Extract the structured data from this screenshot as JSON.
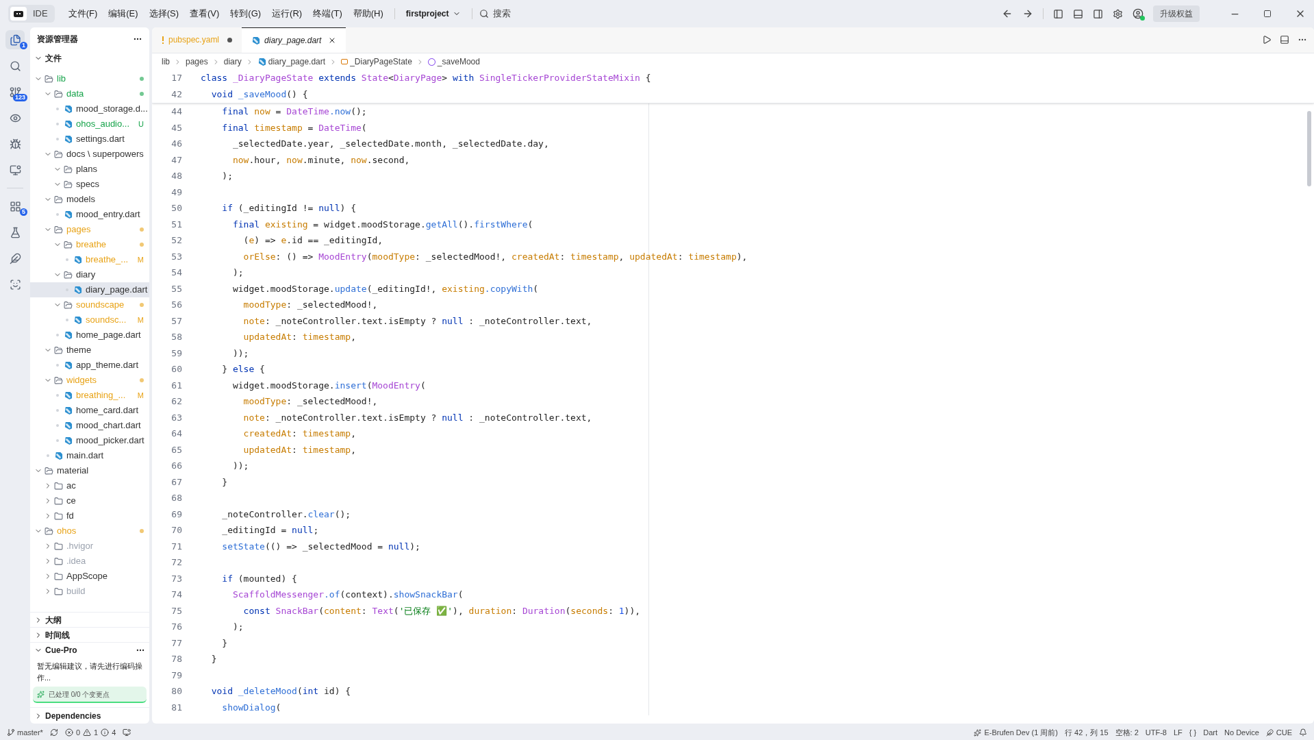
{
  "titlebar": {
    "app": "IDE",
    "menus": [
      "文件(F)",
      "编辑(E)",
      "选择(S)",
      "查看(V)",
      "转到(G)",
      "运行(R)",
      "终端(T)",
      "帮助(H)"
    ],
    "project": "firstproject",
    "search": "搜索",
    "upgrade": "升级权益"
  },
  "activity_bar": [
    {
      "badge": "1",
      "selected": true
    },
    {
      "selected": false
    },
    {
      "badge": "123",
      "selected": false
    },
    {
      "selected": false
    },
    {
      "selected": false
    },
    {
      "selected": false
    },
    {
      "badge": "5",
      "selected": false
    },
    {
      "selected": false
    },
    {
      "selected": false
    },
    {
      "selected": false
    }
  ],
  "explorer": {
    "title": "资源管理器",
    "section": "文件",
    "tree": [
      {
        "name": "lib",
        "kind": "folder",
        "expanded": true,
        "color": "#16a34a",
        "changed": true,
        "children": [
          {
            "name": "data",
            "kind": "folder",
            "expanded": true,
            "color": "#16a34a",
            "changed": true,
            "children": [
              {
                "name": "mood_storage.d...",
                "kind": "file",
                "color": "#333333",
                "selected": false
              },
              {
                "name": "ohos_audio...",
                "kind": "file",
                "color": "#16a34a",
                "badge": "U",
                "selected": false
              },
              {
                "name": "settings.dart",
                "kind": "file",
                "color": "#333333",
                "selected": false
              }
            ]
          },
          {
            "name": "docs \\ superpowers",
            "kind": "folder",
            "expanded": true,
            "color": "#333333",
            "changed": false,
            "children": [
              {
                "name": "plans",
                "kind": "folder",
                "expanded": true,
                "color": "#333333",
                "changed": false
              },
              {
                "name": "specs",
                "kind": "folder",
                "expanded": true,
                "color": "#333333",
                "changed": false
              }
            ]
          },
          {
            "name": "models",
            "kind": "folder",
            "expanded": true,
            "color": "#333333",
            "changed": false,
            "children": [
              {
                "name": "mood_entry.dart",
                "kind": "file",
                "color": "#333333",
                "selected": false
              }
            ]
          },
          {
            "name": "pages",
            "kind": "folder",
            "expanded": true,
            "color": "#e8a317",
            "changed": true,
            "children": [
              {
                "name": "breathe",
                "kind": "folder",
                "expanded": true,
                "color": "#e8a317",
                "changed": true,
                "children": [
                  {
                    "name": "breathe_...",
                    "kind": "file",
                    "color": "#e8a317",
                    "badge": "M",
                    "selected": false
                  }
                ]
              },
              {
                "name": "diary",
                "kind": "folder",
                "expanded": true,
                "color": "#333333",
                "changed": false,
                "children": [
                  {
                    "name": "diary_page.dart",
                    "kind": "file",
                    "color": "#333333",
                    "selected": true
                  }
                ]
              },
              {
                "name": "soundscape",
                "kind": "folder",
                "expanded": true,
                "color": "#e8a317",
                "changed": true,
                "children": [
                  {
                    "name": "soundsc...",
                    "kind": "file",
                    "color": "#e8a317",
                    "badge": "M",
                    "selected": false
                  }
                ]
              },
              {
                "name": "home_page.dart",
                "kind": "file",
                "color": "#333333",
                "selected": false
              }
            ]
          },
          {
            "name": "theme",
            "kind": "folder",
            "expanded": true,
            "color": "#333333",
            "changed": false,
            "children": [
              {
                "name": "app_theme.dart",
                "kind": "file",
                "color": "#333333",
                "selected": false
              }
            ]
          },
          {
            "name": "widgets",
            "kind": "folder",
            "expanded": true,
            "color": "#e8a317",
            "changed": true,
            "children": [
              {
                "name": "breathing_...",
                "kind": "file",
                "color": "#e8a317",
                "badge": "M",
                "selected": false
              },
              {
                "name": "home_card.dart",
                "kind": "file",
                "color": "#333333",
                "selected": false
              },
              {
                "name": "mood_chart.dart",
                "kind": "file",
                "color": "#333333",
                "selected": false
              },
              {
                "name": "mood_picker.dart",
                "kind": "file",
                "color": "#333333",
                "selected": false
              }
            ]
          },
          {
            "name": "main.dart",
            "kind": "file",
            "color": "#333333",
            "selected": false
          }
        ]
      },
      {
        "name": "material",
        "kind": "folder",
        "expanded": true,
        "color": "#333333",
        "changed": false,
        "children": [
          {
            "name": "ac",
            "kind": "folder",
            "expanded": false,
            "color": "#333333",
            "changed": false
          },
          {
            "name": "ce",
            "kind": "folder",
            "expanded": false,
            "color": "#333333",
            "changed": false
          },
          {
            "name": "fd",
            "kind": "folder",
            "expanded": false,
            "color": "#333333",
            "changed": false
          }
        ]
      },
      {
        "name": "ohos",
        "kind": "folder",
        "expanded": true,
        "color": "#e8a317",
        "changed": true,
        "children": [
          {
            "name": ".hvigor",
            "kind": "folder",
            "expanded": false,
            "color": "#9ca3af",
            "changed": false
          },
          {
            "name": ".idea",
            "kind": "folder",
            "expanded": false,
            "color": "#9ca3af",
            "changed": false
          },
          {
            "name": "AppScope",
            "kind": "folder",
            "expanded": false,
            "color": "#333333",
            "changed": false
          },
          {
            "name": "build",
            "kind": "folder",
            "expanded": false,
            "color": "#9ca3af",
            "changed": false
          }
        ]
      }
    ]
  },
  "panels": [
    {
      "title": "大纲",
      "expanded": false
    },
    {
      "title": "时间线",
      "expanded": false
    }
  ],
  "cue_pro": {
    "title": "Cue-Pro",
    "expanded": true,
    "message": "暂无编辑建议，请先进行编码操作...",
    "progress": "已处理 0/0 个变更点"
  },
  "dependencies": {
    "title": "Dependencies",
    "expanded": false
  },
  "tabs": [
    {
      "label": "pubspec.yaml",
      "kind": "warning",
      "selected": false,
      "modified": true
    },
    {
      "label": "diary_page.dart",
      "kind": "dart",
      "selected": true,
      "modified": false
    }
  ],
  "breadcrumb": [
    {
      "label": "lib",
      "kind": "folder"
    },
    {
      "label": "pages",
      "kind": "folder"
    },
    {
      "label": "diary",
      "kind": "folder"
    },
    {
      "label": "diary_page.dart",
      "kind": "dart"
    },
    {
      "label": "_DiaryPageState",
      "kind": "class"
    },
    {
      "label": "_saveMood",
      "kind": "function"
    }
  ],
  "sticky_lines": [
    {
      "number": "17",
      "tokens": [
        {
          "kind": "k",
          "text": "class "
        },
        {
          "kind": "t",
          "text": "_DiaryPageState "
        },
        {
          "kind": "k",
          "text": "extends "
        },
        {
          "kind": "t",
          "text": "State"
        },
        {
          "kind": "p",
          "text": "<"
        },
        {
          "kind": "t",
          "text": "DiaryPage"
        },
        {
          "kind": "p",
          "text": "> "
        },
        {
          "kind": "k",
          "text": "with "
        },
        {
          "kind": "t",
          "text": "SingleTickerProviderStateMixin "
        },
        {
          "kind": "p",
          "text": "{"
        }
      ]
    },
    {
      "number": "42",
      "tokens": [
        {
          "kind": "k",
          "text": "  void "
        },
        {
          "kind": "m",
          "text": "_saveMood"
        },
        {
          "kind": "p",
          "text": "() {"
        }
      ]
    }
  ],
  "lines": [
    {
      "number": "44",
      "tokens": [
        {
          "kind": "k",
          "text": "    final "
        },
        {
          "kind": "f",
          "text": "now"
        },
        {
          "kind": "p",
          "text": " = "
        },
        {
          "kind": "t",
          "text": "DateTime"
        },
        {
          "kind": "m",
          "text": ".now"
        },
        {
          "kind": "p",
          "text": "();"
        }
      ]
    },
    {
      "number": "45",
      "tokens": [
        {
          "kind": "k",
          "text": "    final "
        },
        {
          "kind": "f",
          "text": "timestamp"
        },
        {
          "kind": "p",
          "text": " = "
        },
        {
          "kind": "t",
          "text": "DateTime"
        },
        {
          "kind": "p",
          "text": "("
        }
      ]
    },
    {
      "number": "46",
      "tokens": [
        {
          "kind": "p",
          "text": "      _selectedDate.year, _selectedDate.month, _selectedDate.day,"
        }
      ]
    },
    {
      "number": "47",
      "tokens": [
        {
          "kind": "f",
          "text": "      now"
        },
        {
          "kind": "p",
          "text": ".hour, "
        },
        {
          "kind": "f",
          "text": "now"
        },
        {
          "kind": "p",
          "text": ".minute, "
        },
        {
          "kind": "f",
          "text": "now"
        },
        {
          "kind": "p",
          "text": ".second,"
        }
      ]
    },
    {
      "number": "48",
      "tokens": [
        {
          "kind": "p",
          "text": "    );"
        }
      ]
    },
    {
      "number": "49"
    },
    {
      "number": "50",
      "tokens": [
        {
          "kind": "k",
          "text": "    if "
        },
        {
          "kind": "p",
          "text": "(_editingId != "
        },
        {
          "kind": "k",
          "text": "null"
        },
        {
          "kind": "p",
          "text": ") {"
        }
      ]
    },
    {
      "number": "51",
      "tokens": [
        {
          "kind": "k",
          "text": "      final "
        },
        {
          "kind": "f",
          "text": "existing"
        },
        {
          "kind": "p",
          "text": " = widget.moodStorage."
        },
        {
          "kind": "m",
          "text": "getAll"
        },
        {
          "kind": "p",
          "text": "()."
        },
        {
          "kind": "m",
          "text": "firstWhere"
        },
        {
          "kind": "p",
          "text": "("
        }
      ]
    },
    {
      "number": "52",
      "tokens": [
        {
          "kind": "p",
          "text": "        ("
        },
        {
          "kind": "f",
          "text": "e"
        },
        {
          "kind": "p",
          "text": ") => "
        },
        {
          "kind": "f",
          "text": "e"
        },
        {
          "kind": "p",
          "text": ".id == _editingId,"
        }
      ]
    },
    {
      "number": "53",
      "tokens": [
        {
          "kind": "f",
          "text": "        orElse"
        },
        {
          "kind": "p",
          "text": ": () => "
        },
        {
          "kind": "t",
          "text": "MoodEntry"
        },
        {
          "kind": "p",
          "text": "("
        },
        {
          "kind": "f",
          "text": "moodType"
        },
        {
          "kind": "p",
          "text": ": _selectedMood!, "
        },
        {
          "kind": "f",
          "text": "createdAt"
        },
        {
          "kind": "p",
          "text": ": "
        },
        {
          "kind": "f",
          "text": "timestamp"
        },
        {
          "kind": "p",
          "text": ", "
        },
        {
          "kind": "f",
          "text": "updatedAt"
        },
        {
          "kind": "p",
          "text": ": "
        },
        {
          "kind": "f",
          "text": "timestamp"
        },
        {
          "kind": "p",
          "text": "),"
        }
      ]
    },
    {
      "number": "54",
      "tokens": [
        {
          "kind": "p",
          "text": "      );"
        }
      ]
    },
    {
      "number": "55",
      "tokens": [
        {
          "kind": "p",
          "text": "      widget.moodStorage."
        },
        {
          "kind": "m",
          "text": "update"
        },
        {
          "kind": "p",
          "text": "(_editingId!, "
        },
        {
          "kind": "f",
          "text": "existing"
        },
        {
          "kind": "m",
          "text": ".copyWith"
        },
        {
          "kind": "p",
          "text": "("
        }
      ]
    },
    {
      "number": "56",
      "tokens": [
        {
          "kind": "f",
          "text": "        moodType"
        },
        {
          "kind": "p",
          "text": ": _selectedMood!,"
        }
      ]
    },
    {
      "number": "57",
      "tokens": [
        {
          "kind": "f",
          "text": "        note"
        },
        {
          "kind": "p",
          "text": ": _noteController.text.isEmpty ? "
        },
        {
          "kind": "k",
          "text": "null"
        },
        {
          "kind": "p",
          "text": " : _noteController.text,"
        }
      ]
    },
    {
      "number": "58",
      "tokens": [
        {
          "kind": "f",
          "text": "        updatedAt"
        },
        {
          "kind": "p",
          "text": ": "
        },
        {
          "kind": "f",
          "text": "timestamp"
        },
        {
          "kind": "p",
          "text": ","
        }
      ]
    },
    {
      "number": "59",
      "tokens": [
        {
          "kind": "p",
          "text": "      ));"
        }
      ]
    },
    {
      "number": "60",
      "tokens": [
        {
          "kind": "p",
          "text": "    } "
        },
        {
          "kind": "k",
          "text": "else"
        },
        {
          "kind": "p",
          "text": " {"
        }
      ]
    },
    {
      "number": "61",
      "tokens": [
        {
          "kind": "p",
          "text": "      widget.moodStorage."
        },
        {
          "kind": "m",
          "text": "insert"
        },
        {
          "kind": "p",
          "text": "("
        },
        {
          "kind": "t",
          "text": "MoodEntry"
        },
        {
          "kind": "p",
          "text": "("
        }
      ]
    },
    {
      "number": "62",
      "tokens": [
        {
          "kind": "f",
          "text": "        moodType"
        },
        {
          "kind": "p",
          "text": ": _selectedMood!,"
        }
      ]
    },
    {
      "number": "63",
      "tokens": [
        {
          "kind": "f",
          "text": "        note"
        },
        {
          "kind": "p",
          "text": ": _noteController.text.isEmpty ? "
        },
        {
          "kind": "k",
          "text": "null"
        },
        {
          "kind": "p",
          "text": " : _noteController.text,"
        }
      ]
    },
    {
      "number": "64",
      "tokens": [
        {
          "kind": "f",
          "text": "        createdAt"
        },
        {
          "kind": "p",
          "text": ": "
        },
        {
          "kind": "f",
          "text": "timestamp"
        },
        {
          "kind": "p",
          "text": ","
        }
      ]
    },
    {
      "number": "65",
      "tokens": [
        {
          "kind": "f",
          "text": "        updatedAt"
        },
        {
          "kind": "p",
          "text": ": "
        },
        {
          "kind": "f",
          "text": "timestamp"
        },
        {
          "kind": "p",
          "text": ","
        }
      ]
    },
    {
      "number": "66",
      "tokens": [
        {
          "kind": "p",
          "text": "      ));"
        }
      ]
    },
    {
      "number": "67",
      "tokens": [
        {
          "kind": "p",
          "text": "    }"
        }
      ]
    },
    {
      "number": "68"
    },
    {
      "number": "69",
      "tokens": [
        {
          "kind": "p",
          "text": "    _noteController."
        },
        {
          "kind": "m",
          "text": "clear"
        },
        {
          "kind": "p",
          "text": "();"
        }
      ]
    },
    {
      "number": "70",
      "tokens": [
        {
          "kind": "p",
          "text": "    _editingId = "
        },
        {
          "kind": "k",
          "text": "null"
        },
        {
          "kind": "p",
          "text": ";"
        }
      ]
    },
    {
      "number": "71",
      "tokens": [
        {
          "kind": "m",
          "text": "    setState"
        },
        {
          "kind": "p",
          "text": "(() => _selectedMood = "
        },
        {
          "kind": "k",
          "text": "null"
        },
        {
          "kind": "p",
          "text": ");"
        }
      ]
    },
    {
      "number": "72"
    },
    {
      "number": "73",
      "tokens": [
        {
          "kind": "k",
          "text": "    if "
        },
        {
          "kind": "p",
          "text": "(mounted) {"
        }
      ]
    },
    {
      "number": "74",
      "tokens": [
        {
          "kind": "t",
          "text": "      ScaffoldMessenger"
        },
        {
          "kind": "m",
          "text": ".of"
        },
        {
          "kind": "p",
          "text": "(context)."
        },
        {
          "kind": "m",
          "text": "showSnackBar"
        },
        {
          "kind": "p",
          "text": "("
        }
      ]
    },
    {
      "number": "75",
      "tokens": [
        {
          "kind": "k",
          "text": "        const "
        },
        {
          "kind": "t",
          "text": "SnackBar"
        },
        {
          "kind": "p",
          "text": "("
        },
        {
          "kind": "f",
          "text": "content"
        },
        {
          "kind": "p",
          "text": ": "
        },
        {
          "kind": "t",
          "text": "Text"
        },
        {
          "kind": "p",
          "text": "("
        },
        {
          "kind": "s",
          "text": "'已保存 ✅'"
        },
        {
          "kind": "p",
          "text": "), "
        },
        {
          "kind": "f",
          "text": "duration"
        },
        {
          "kind": "p",
          "text": ": "
        },
        {
          "kind": "t",
          "text": "Duration"
        },
        {
          "kind": "p",
          "text": "("
        },
        {
          "kind": "f",
          "text": "seconds"
        },
        {
          "kind": "p",
          "text": ": "
        },
        {
          "kind": "n",
          "text": "1"
        },
        {
          "kind": "p",
          "text": ")),"
        }
      ]
    },
    {
      "number": "76",
      "tokens": [
        {
          "kind": "p",
          "text": "      );"
        }
      ]
    },
    {
      "number": "77",
      "tokens": [
        {
          "kind": "p",
          "text": "    }"
        }
      ]
    },
    {
      "number": "78",
      "tokens": [
        {
          "kind": "p",
          "text": "  }"
        }
      ]
    },
    {
      "number": "79"
    },
    {
      "number": "80",
      "tokens": [
        {
          "kind": "k",
          "text": "  void "
        },
        {
          "kind": "m",
          "text": "_deleteMood"
        },
        {
          "kind": "p",
          "text": "("
        },
        {
          "kind": "k",
          "text": "int"
        },
        {
          "kind": "p",
          "text": " id) {"
        }
      ]
    },
    {
      "number": "81",
      "tokens": [
        {
          "kind": "m",
          "text": "    showDialog"
        },
        {
          "kind": "p",
          "text": "("
        }
      ]
    }
  ],
  "status_bar": {
    "branch": "master*",
    "errors": "0",
    "warnings": "1",
    "infos": "4",
    "right": [
      {
        "kind": "git",
        "text": "E-Brufen Dev (1 周前)"
      },
      {
        "kind": "text",
        "text": "行 42，列 15"
      },
      {
        "kind": "text",
        "text": "空格: 2"
      },
      {
        "kind": "text",
        "text": "UTF-8"
      },
      {
        "kind": "text",
        "text": "LF"
      },
      {
        "kind": "text",
        "text": "{ }"
      },
      {
        "kind": "text",
        "text": "Dart"
      },
      {
        "kind": "text",
        "text": "No Device"
      },
      {
        "kind": "cue",
        "text": "CUE"
      }
    ]
  }
}
